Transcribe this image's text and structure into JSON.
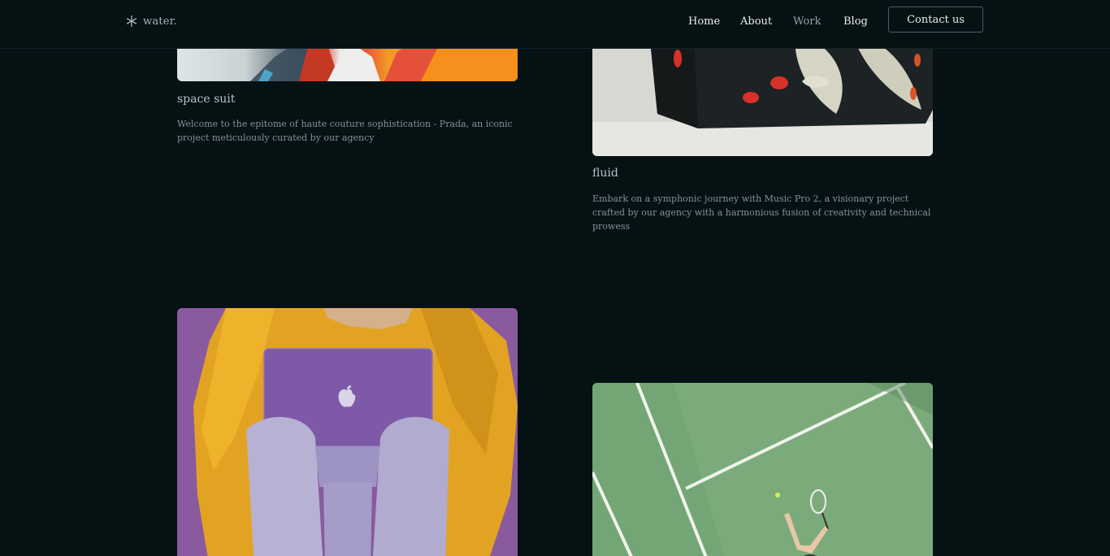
{
  "brand": {
    "name": "water."
  },
  "nav": {
    "home": "Home",
    "about": "About",
    "work": "Work",
    "blog": "Blog"
  },
  "header": {
    "contact_label": "Contact us"
  },
  "projects": [
    {
      "title": "space suit",
      "description": "Welcome to the epitome of haute couture sophistication - Prada, an iconic project meticulously curated by our agency"
    },
    {
      "title": "fluid",
      "description": "Embark on a symphonic journey with Music Pro 2, a visionary project crafted by our agency with a harmonious fusion of creativity and technical prowess"
    }
  ],
  "colors": {
    "background": "#061114",
    "text_muted": "#7f9498",
    "title": "#b4c3c6",
    "nav_text": "#e6eef0"
  }
}
